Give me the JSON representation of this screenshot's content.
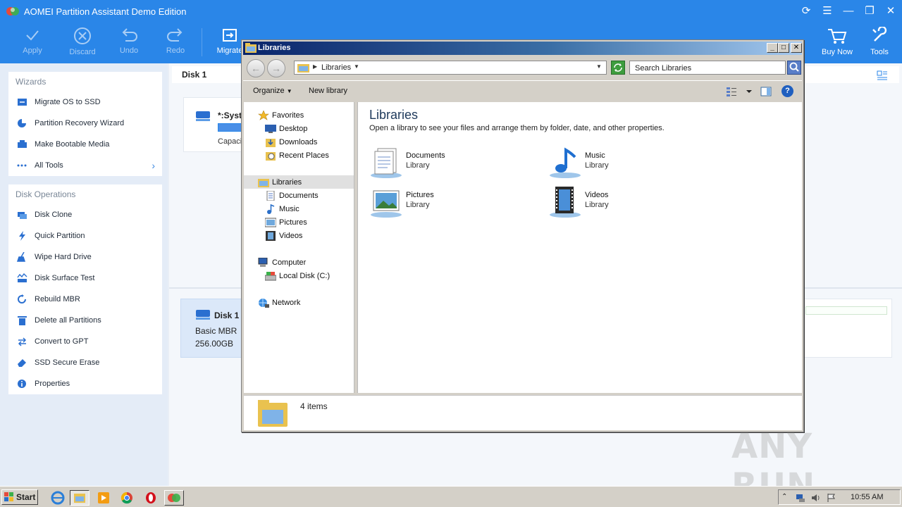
{
  "aomei": {
    "title": "AOMEI Partition Assistant Demo Edition",
    "toolbar": {
      "apply": "Apply",
      "discard": "Discard",
      "undo": "Undo",
      "redo": "Redo",
      "migrate": "Migrate",
      "buy_now": "Buy Now",
      "tools": "Tools"
    },
    "wizards": {
      "heading": "Wizards",
      "items": [
        "Migrate OS to SSD",
        "Partition Recovery Wizard",
        "Make Bootable Media",
        "All Tools"
      ]
    },
    "disk_ops": {
      "heading": "Disk Operations",
      "items": [
        "Disk Clone",
        "Quick Partition",
        "Wipe Hard Drive",
        "Disk Surface Test",
        "Rebuild MBR",
        "Delete all Partitions",
        "Convert to GPT",
        "SSD Secure Erase",
        "Properties"
      ]
    },
    "main": {
      "disk_header": "Disk 1",
      "partition_name": "*:Syst",
      "partition_capacity": "Capaci",
      "disk_card": {
        "name": "Disk 1",
        "type": "Basic MBR",
        "size": "256.00GB"
      }
    },
    "accent": "#2a86e8"
  },
  "explorer": {
    "title": "Libraries",
    "address": "Libraries",
    "search_placeholder": "Search Libraries",
    "commands": {
      "organize": "Organize",
      "new_library": "New library"
    },
    "nav": {
      "favorites": "Favorites",
      "desktop": "Desktop",
      "downloads": "Downloads",
      "recent": "Recent Places",
      "libraries": "Libraries",
      "documents": "Documents",
      "music": "Music",
      "pictures": "Pictures",
      "videos": "Videos",
      "computer": "Computer",
      "local_disk": "Local Disk (C:)",
      "network": "Network"
    },
    "content": {
      "title": "Libraries",
      "description": "Open a library to see your files and arrange them by folder, date, and other properties.",
      "tiles": [
        {
          "name": "Documents",
          "sub": "Library"
        },
        {
          "name": "Music",
          "sub": "Library"
        },
        {
          "name": "Pictures",
          "sub": "Library"
        },
        {
          "name": "Videos",
          "sub": "Library"
        }
      ]
    },
    "status": "4 items"
  },
  "taskbar": {
    "start": "Start",
    "time": "10:55 AM"
  },
  "watermark": "ANY RUN"
}
